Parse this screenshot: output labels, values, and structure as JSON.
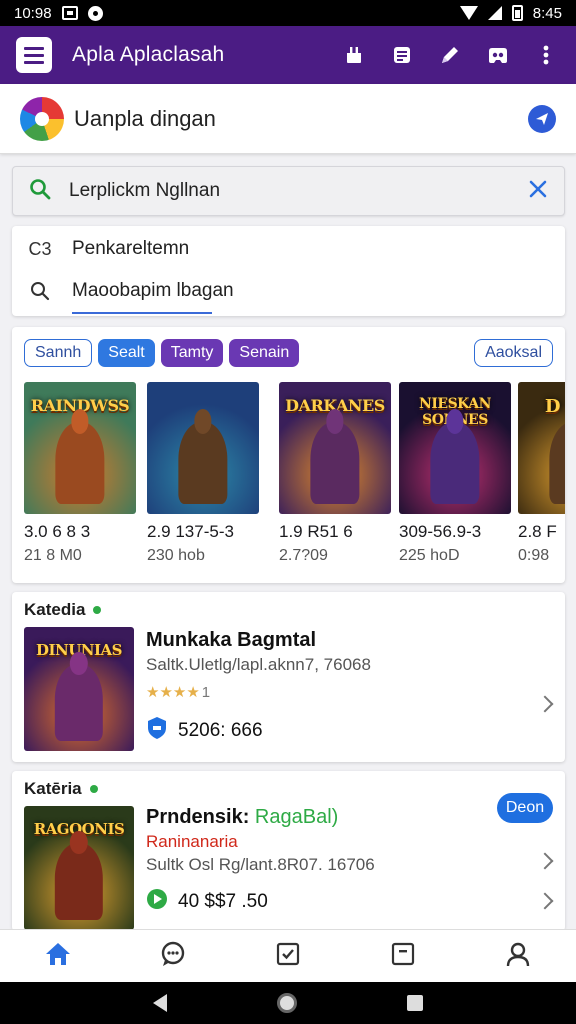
{
  "status_bar": {
    "time_left": "10:98",
    "time_right": "8:45"
  },
  "app_bar": {
    "title": "Apla Aplaclasah"
  },
  "account": {
    "name": "Uanpla dingan"
  },
  "search": {
    "value": "Lerplickm Ngllnan"
  },
  "suggestions": [
    {
      "icon": "history-icon",
      "glyph": "C3",
      "label": "Penkareltemn"
    },
    {
      "icon": "search-icon",
      "glyph": "",
      "label": "Maoobapim lbagan"
    }
  ],
  "chips": [
    {
      "label": "Sannh",
      "style": "outline"
    },
    {
      "label": "Sealt",
      "style": "blue"
    },
    {
      "label": "Tamty",
      "style": "purple"
    },
    {
      "label": "Senain",
      "style": "purple"
    }
  ],
  "chip_more": "Aaoksal",
  "featured_games": [
    {
      "cover_title": "RAINDWSS",
      "version": "3.0 6 8 3",
      "sub": "21 8 M0",
      "colors": [
        "#3f7a5a",
        "#d27b2c",
        "#9a4a20"
      ]
    },
    {
      "cover_title": "",
      "version": "2.9 137-5-3",
      "sub": "230 hob",
      "colors": [
        "#1e3f7a",
        "#2d8aa8",
        "#5a3a20"
      ]
    },
    {
      "cover_title": "DARKANES",
      "version": "1.9 R51 6",
      "sub": "2.7?09",
      "colors": [
        "#3a1f5a",
        "#e08a2a",
        "#5a2a60"
      ]
    },
    {
      "cover_title": "NIESKAN SONNES",
      "version": "309-56.9-3",
      "sub": "225 hoD",
      "colors": [
        "#1a1030",
        "#c03070",
        "#4a2a7a"
      ]
    },
    {
      "cover_title": "D",
      "version": "2.8 F",
      "sub": "0:98",
      "colors": [
        "#3a2a10",
        "#e0a030",
        "#5a3a20"
      ]
    }
  ],
  "categories": [
    {
      "label": "Katedia",
      "cover_title": "DINUNIAS",
      "title": "Munkaka Bagmtal",
      "subtitle": "Saltk.Uletlg/lapl.aknn7, 76068",
      "stars": "★★★★",
      "rating_count": "1",
      "price": "5206: 666",
      "badge_icon": "shield-icon",
      "colors": [
        "#3a1a5a",
        "#e0702a",
        "#6a2a6a"
      ]
    },
    {
      "label": "Katēria",
      "cover_title": "RAGOONIS",
      "title": "Prndensik:",
      "title_accent": "RagaBal)",
      "accent_line": "Raninanaria",
      "subtitle": "Sultk Osl Rg/lant.8R07. 16706",
      "price": "40 $$7 .50",
      "deal": "Deon",
      "badge_icon": "play-store-icon",
      "colors": [
        "#2a3a1a",
        "#e0a030",
        "#7a2a1a"
      ]
    }
  ],
  "colors": {
    "app_bar": "#4b1c84",
    "accent_blue": "#2f78e0",
    "accent_purple": "#6a38b3",
    "green": "#2eaa45",
    "red_accent": "#d0281a"
  },
  "bottom_nav": [
    {
      "name": "home",
      "icon": "home-icon",
      "active": true
    },
    {
      "name": "chat",
      "icon": "chat-icon",
      "active": false
    },
    {
      "name": "tasks",
      "icon": "checklist-icon",
      "active": false
    },
    {
      "name": "library",
      "icon": "inbox-icon",
      "active": false
    },
    {
      "name": "profile",
      "icon": "person-icon",
      "active": false
    }
  ]
}
